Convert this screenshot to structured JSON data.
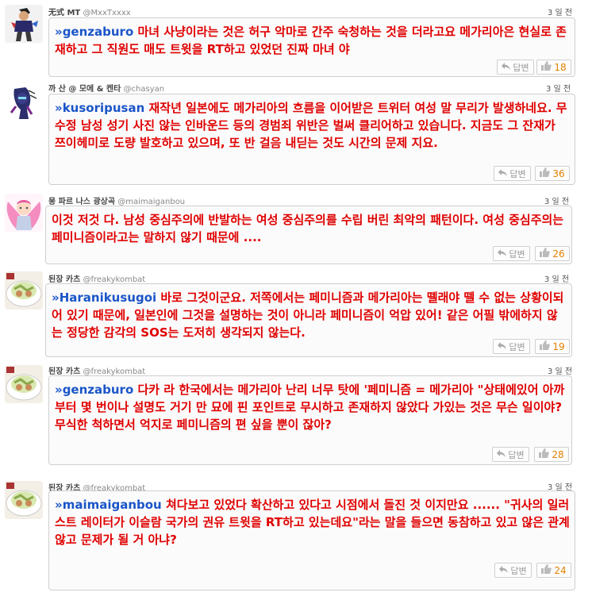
{
  "posts": [
    {
      "name": "无式 MT",
      "handle": "@MxxTxxxx",
      "time": "3 일 전",
      "mention": "»genzaburo",
      "text": " 마녀 사냥이라는 것은 허구 악마로 간주 숙청하는 것을 더라고요 메가리아은 현실로 존재하고 그 직원도 매도 트윗을 RT하고 있었던 진짜 마녀 야",
      "reply": "답변",
      "likes": "18"
    },
    {
      "name": "까 산 @ 모에 & 켄타",
      "handle": "@chasyan",
      "time": "3 일 전",
      "mention": "»kusoripusan",
      "text": " 재작년 일본에도 메가리아의 흐름을 이어받은 트위터 여성 말 무리가 발생하네요. 무수정 남성 성기 사진 않는 인바운드 등의 경범죄 위반은 벌써 클리어하고 있습니다. 지금도 그 잔재가 쯔이헤미로 도량 발호하고 있으며, 또 반 걸음 내딛는 것도 시간의 문제 지요.",
      "reply": "답변",
      "likes": "36"
    },
    {
      "name": "몽 파르 나스 광상곡",
      "handle": "@maimaiganbou",
      "time": "3 일 전",
      "mention": "",
      "text": "이것 저것 다. 남성 중심주의에 반발하는 여성 중심주의를 수립 버린 최악의 패턴이다. 여성 중심주의는 페미니즘이라고는 말하지 않기 때문에 ....",
      "reply": "답변",
      "likes": "26"
    },
    {
      "name": "된장 카츠",
      "handle": "@freakykombat",
      "time": "3 일 전",
      "mention": "»Haranikusugoi",
      "text": " 바로 그것이군요. 저쪽에서는 페미니즘과 메가리아는 뗄래야 뗄 수 없는 상황이되어 있기 때문에, 일본인에 그것을 설명하는 것이 아니라 페미니즘이 억압 있어! 같은 어필 밖에하지 않는 정당한 감각의 SOS는 도저히 생각되지 않는다.",
      "reply": "답변",
      "likes": "19"
    },
    {
      "name": "된장 카츠",
      "handle": "@freakykombat",
      "time": "3 일 전",
      "mention": "»genzaburo",
      "text": " 다카 라 한국에서는 메가리아 난리 너무 탓에 '페미니즘 = 메가리아 \"상태에있어 아까부터 몇 번이나 설명도 거기 만 묘에 핀 포인트로 무시하고 존재하지 않았다 가있는 것은 무슨 일이야? 무식한 척하면서 억지로 페미니즘의 편 싶을 뿐이 잖아?",
      "reply": "답변",
      "likes": "28"
    },
    {
      "name": "된장 카츠",
      "handle": "@freakykombat",
      "time": "3 일 전",
      "mention": "»maimaiganbou",
      "text": " 쳐다보고 있었다 확산하고 있다고 시점에서 돌진 것 이지만요 ...... \"귀사의 일러스트 레이터가 이슬람 국가의 권유 트윗을 RT하고 있는데요\"라는 말을 들으면 동참하고 있고 않은 관계 않고 문제가 될 거 아냐?",
      "reply": "답변",
      "likes": "24"
    }
  ]
}
